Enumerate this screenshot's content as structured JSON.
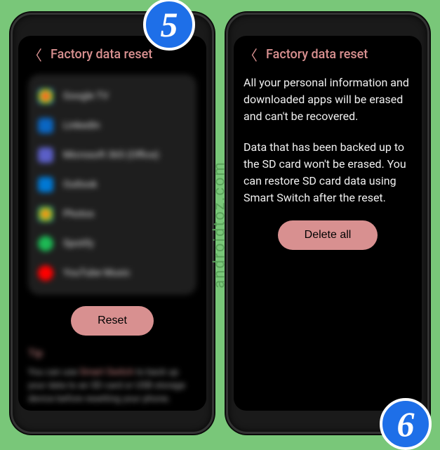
{
  "watermark": "androidtoz.com",
  "step_badges": {
    "left": "5",
    "right": "6"
  },
  "left_phone": {
    "header_title": "Factory data reset",
    "apps": [
      {
        "name": "Google TV",
        "icon_class": "icon-google-tv"
      },
      {
        "name": "LinkedIn",
        "icon_class": "icon-linkedin"
      },
      {
        "name": "Microsoft 365 (Office)",
        "icon_class": "icon-microsoft"
      },
      {
        "name": "Outlook",
        "icon_class": "icon-outlook"
      },
      {
        "name": "Photos",
        "icon_class": "icon-photos"
      },
      {
        "name": "Spotify",
        "icon_class": "icon-spotify"
      },
      {
        "name": "YouTube Music",
        "icon_class": "icon-youtube-music"
      }
    ],
    "action_label": "Reset",
    "tip": {
      "title": "Tip",
      "text_before": "You can use ",
      "highlight": "Smart Switch",
      "text_after": " to back up your data to an SD card or USB storage device before resetting your phone."
    }
  },
  "right_phone": {
    "header_title": "Factory data reset",
    "paragraph1": "All your personal information and downloaded apps will be erased and can't be recovered.",
    "paragraph2": "Data that has been backed up to the SD card won't be erased. You can restore SD card data using Smart Switch after the reset.",
    "action_label": "Delete all"
  }
}
